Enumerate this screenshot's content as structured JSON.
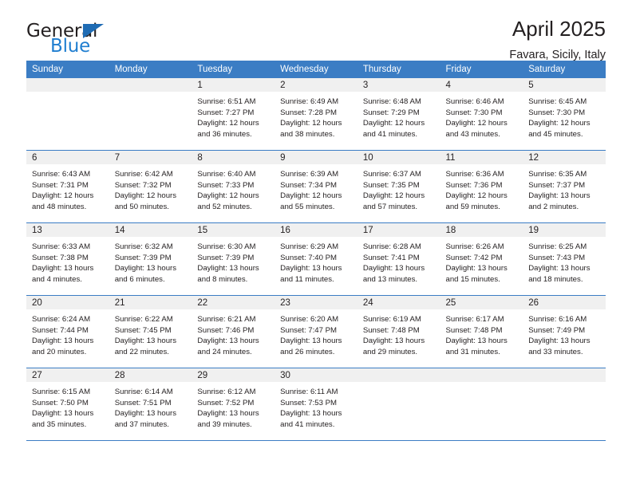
{
  "logo": {
    "word_top": "General",
    "word_bottom": "Blue",
    "triangle_color": "#1f6cb4",
    "blue_color": "#1f7ed0"
  },
  "header": {
    "title": "April 2025",
    "subtitle": "Favara, Sicily, Italy"
  },
  "colors": {
    "header_band": "#3b7dc4",
    "daynum_band": "#f0f0f0",
    "text": "#231f20"
  },
  "weekdays": [
    "Sunday",
    "Monday",
    "Tuesday",
    "Wednesday",
    "Thursday",
    "Friday",
    "Saturday"
  ],
  "weeks": [
    [
      {
        "day": ""
      },
      {
        "day": ""
      },
      {
        "day": "1",
        "sunrise": "Sunrise: 6:51 AM",
        "sunset": "Sunset: 7:27 PM",
        "daylight1": "Daylight: 12 hours",
        "daylight2": "and 36 minutes."
      },
      {
        "day": "2",
        "sunrise": "Sunrise: 6:49 AM",
        "sunset": "Sunset: 7:28 PM",
        "daylight1": "Daylight: 12 hours",
        "daylight2": "and 38 minutes."
      },
      {
        "day": "3",
        "sunrise": "Sunrise: 6:48 AM",
        "sunset": "Sunset: 7:29 PM",
        "daylight1": "Daylight: 12 hours",
        "daylight2": "and 41 minutes."
      },
      {
        "day": "4",
        "sunrise": "Sunrise: 6:46 AM",
        "sunset": "Sunset: 7:30 PM",
        "daylight1": "Daylight: 12 hours",
        "daylight2": "and 43 minutes."
      },
      {
        "day": "5",
        "sunrise": "Sunrise: 6:45 AM",
        "sunset": "Sunset: 7:30 PM",
        "daylight1": "Daylight: 12 hours",
        "daylight2": "and 45 minutes."
      }
    ],
    [
      {
        "day": "6",
        "sunrise": "Sunrise: 6:43 AM",
        "sunset": "Sunset: 7:31 PM",
        "daylight1": "Daylight: 12 hours",
        "daylight2": "and 48 minutes."
      },
      {
        "day": "7",
        "sunrise": "Sunrise: 6:42 AM",
        "sunset": "Sunset: 7:32 PM",
        "daylight1": "Daylight: 12 hours",
        "daylight2": "and 50 minutes."
      },
      {
        "day": "8",
        "sunrise": "Sunrise: 6:40 AM",
        "sunset": "Sunset: 7:33 PM",
        "daylight1": "Daylight: 12 hours",
        "daylight2": "and 52 minutes."
      },
      {
        "day": "9",
        "sunrise": "Sunrise: 6:39 AM",
        "sunset": "Sunset: 7:34 PM",
        "daylight1": "Daylight: 12 hours",
        "daylight2": "and 55 minutes."
      },
      {
        "day": "10",
        "sunrise": "Sunrise: 6:37 AM",
        "sunset": "Sunset: 7:35 PM",
        "daylight1": "Daylight: 12 hours",
        "daylight2": "and 57 minutes."
      },
      {
        "day": "11",
        "sunrise": "Sunrise: 6:36 AM",
        "sunset": "Sunset: 7:36 PM",
        "daylight1": "Daylight: 12 hours",
        "daylight2": "and 59 minutes."
      },
      {
        "day": "12",
        "sunrise": "Sunrise: 6:35 AM",
        "sunset": "Sunset: 7:37 PM",
        "daylight1": "Daylight: 13 hours",
        "daylight2": "and 2 minutes."
      }
    ],
    [
      {
        "day": "13",
        "sunrise": "Sunrise: 6:33 AM",
        "sunset": "Sunset: 7:38 PM",
        "daylight1": "Daylight: 13 hours",
        "daylight2": "and 4 minutes."
      },
      {
        "day": "14",
        "sunrise": "Sunrise: 6:32 AM",
        "sunset": "Sunset: 7:39 PM",
        "daylight1": "Daylight: 13 hours",
        "daylight2": "and 6 minutes."
      },
      {
        "day": "15",
        "sunrise": "Sunrise: 6:30 AM",
        "sunset": "Sunset: 7:39 PM",
        "daylight1": "Daylight: 13 hours",
        "daylight2": "and 8 minutes."
      },
      {
        "day": "16",
        "sunrise": "Sunrise: 6:29 AM",
        "sunset": "Sunset: 7:40 PM",
        "daylight1": "Daylight: 13 hours",
        "daylight2": "and 11 minutes."
      },
      {
        "day": "17",
        "sunrise": "Sunrise: 6:28 AM",
        "sunset": "Sunset: 7:41 PM",
        "daylight1": "Daylight: 13 hours",
        "daylight2": "and 13 minutes."
      },
      {
        "day": "18",
        "sunrise": "Sunrise: 6:26 AM",
        "sunset": "Sunset: 7:42 PM",
        "daylight1": "Daylight: 13 hours",
        "daylight2": "and 15 minutes."
      },
      {
        "day": "19",
        "sunrise": "Sunrise: 6:25 AM",
        "sunset": "Sunset: 7:43 PM",
        "daylight1": "Daylight: 13 hours",
        "daylight2": "and 18 minutes."
      }
    ],
    [
      {
        "day": "20",
        "sunrise": "Sunrise: 6:24 AM",
        "sunset": "Sunset: 7:44 PM",
        "daylight1": "Daylight: 13 hours",
        "daylight2": "and 20 minutes."
      },
      {
        "day": "21",
        "sunrise": "Sunrise: 6:22 AM",
        "sunset": "Sunset: 7:45 PM",
        "daylight1": "Daylight: 13 hours",
        "daylight2": "and 22 minutes."
      },
      {
        "day": "22",
        "sunrise": "Sunrise: 6:21 AM",
        "sunset": "Sunset: 7:46 PM",
        "daylight1": "Daylight: 13 hours",
        "daylight2": "and 24 minutes."
      },
      {
        "day": "23",
        "sunrise": "Sunrise: 6:20 AM",
        "sunset": "Sunset: 7:47 PM",
        "daylight1": "Daylight: 13 hours",
        "daylight2": "and 26 minutes."
      },
      {
        "day": "24",
        "sunrise": "Sunrise: 6:19 AM",
        "sunset": "Sunset: 7:48 PM",
        "daylight1": "Daylight: 13 hours",
        "daylight2": "and 29 minutes."
      },
      {
        "day": "25",
        "sunrise": "Sunrise: 6:17 AM",
        "sunset": "Sunset: 7:48 PM",
        "daylight1": "Daylight: 13 hours",
        "daylight2": "and 31 minutes."
      },
      {
        "day": "26",
        "sunrise": "Sunrise: 6:16 AM",
        "sunset": "Sunset: 7:49 PM",
        "daylight1": "Daylight: 13 hours",
        "daylight2": "and 33 minutes."
      }
    ],
    [
      {
        "day": "27",
        "sunrise": "Sunrise: 6:15 AM",
        "sunset": "Sunset: 7:50 PM",
        "daylight1": "Daylight: 13 hours",
        "daylight2": "and 35 minutes."
      },
      {
        "day": "28",
        "sunrise": "Sunrise: 6:14 AM",
        "sunset": "Sunset: 7:51 PM",
        "daylight1": "Daylight: 13 hours",
        "daylight2": "and 37 minutes."
      },
      {
        "day": "29",
        "sunrise": "Sunrise: 6:12 AM",
        "sunset": "Sunset: 7:52 PM",
        "daylight1": "Daylight: 13 hours",
        "daylight2": "and 39 minutes."
      },
      {
        "day": "30",
        "sunrise": "Sunrise: 6:11 AM",
        "sunset": "Sunset: 7:53 PM",
        "daylight1": "Daylight: 13 hours",
        "daylight2": "and 41 minutes."
      },
      {
        "day": ""
      },
      {
        "day": ""
      },
      {
        "day": ""
      }
    ]
  ]
}
